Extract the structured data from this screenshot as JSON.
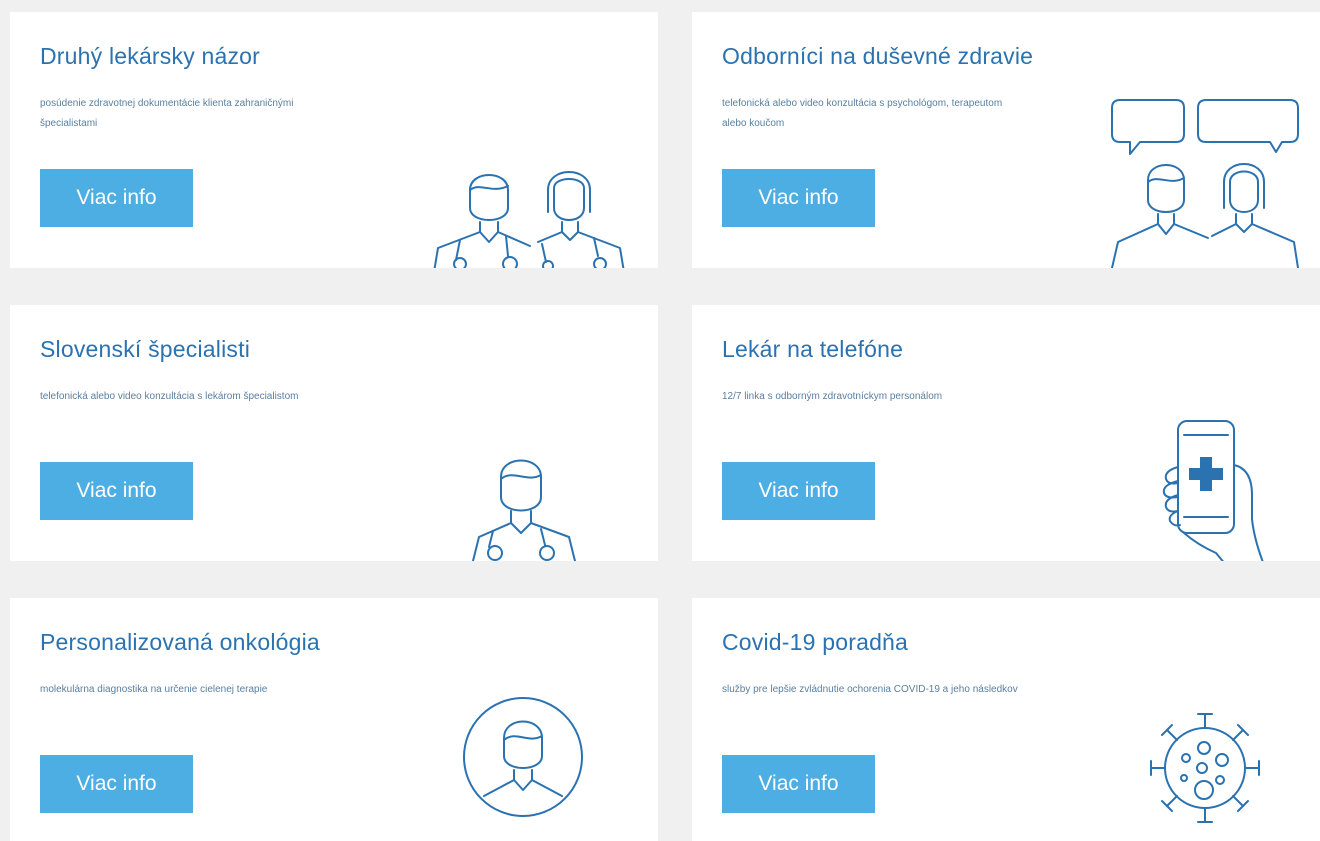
{
  "cards": [
    {
      "title": "Druhý lekársky názor",
      "description": "posúdenie zdravotnej dokumentácie klienta zahraničnými špecialistami",
      "button": "Viac info",
      "icon": "two-doctors-icon"
    },
    {
      "title": "Odborníci na duševné zdravie",
      "description": "telefonická alebo video konzultácia s psychológom, terapeutom alebo koučom",
      "button": "Viac info",
      "icon": "two-people-chat-icon"
    },
    {
      "title": "Slovenskí špecialisti",
      "description": "telefonická alebo video konzultácia s lekárom špecialistom",
      "button": "Viac info",
      "icon": "doctor-icon"
    },
    {
      "title": "Lekár na telefóne",
      "description": "12/7 linka s odborným zdravotníckym personálom",
      "button": "Viac info",
      "icon": "phone-medical-icon"
    },
    {
      "title": "Personalizovaná onkológia",
      "description": "molekulárna diagnostika na určenie cielenej terapie",
      "button": "Viac info",
      "icon": "person-circle-icon"
    },
    {
      "title": "Covid-19 poradňa",
      "description": "služby pre lepšie zvládnutie ochorenia COVID-19 a jeho následkov",
      "button": "Viac info",
      "icon": "virus-icon"
    }
  ],
  "colors": {
    "accent": "#4daee3",
    "title": "#2a72b0",
    "text": "#5a7fa0",
    "background": "#f0f0f0",
    "card": "#ffffff"
  }
}
